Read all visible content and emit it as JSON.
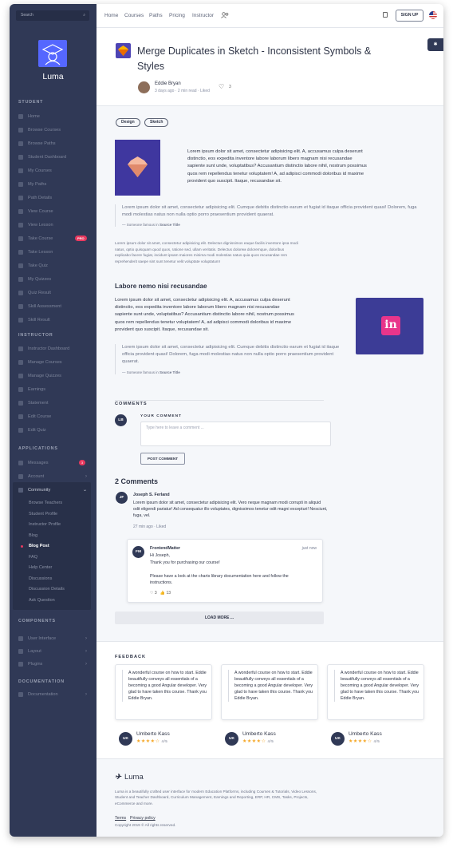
{
  "sidebar": {
    "search_placeholder": "Search",
    "brand": "Luma",
    "sections": {
      "student": "STUDENT",
      "instructor": "INSTRUCTOR",
      "applications": "APPLICATIONS",
      "components": "COMPONENTS",
      "documentation": "DOCUMENTATION"
    },
    "student_items": [
      "Home",
      "Browse Courses",
      "Browse Paths",
      "Student Dashboard",
      "My Courses",
      "My Paths",
      "Path Details",
      "View Course",
      "View Lesson",
      "Take Course",
      "Take Lesson",
      "Take Quiz",
      "My Quizzes",
      "Quiz Result",
      "Skill Assessment",
      "Skill Result"
    ],
    "take_course_badge": "PRO",
    "instructor_items": [
      "Instructor Dashboard",
      "Manage Courses",
      "Manage Quizzes",
      "Earnings",
      "Statement",
      "Edit Course",
      "Edit Quiz"
    ],
    "app_items": [
      "Messages",
      "Account",
      "Community"
    ],
    "messages_badge": "3",
    "community_sub": [
      "Browse Teachers",
      "Student Profile",
      "Instructor Profile",
      "Blog",
      "Blog Post",
      "FAQ",
      "Help Center",
      "Discussions",
      "Discussion Details",
      "Ask Question"
    ],
    "component_items": [
      "User Interface",
      "Layout",
      "Plugins"
    ],
    "doc_items": [
      "Documentation"
    ]
  },
  "topbar": {
    "nav": [
      "Home",
      "Courses",
      "Paths",
      "Pricing",
      "Instructor"
    ],
    "signup": "SIGN UP"
  },
  "post": {
    "title": "Merge Duplicates in Sketch - Inconsistent Symbols & Styles",
    "author": "Eddie Bryan",
    "meta": "3 days ago · 2 min read · Liked",
    "likes": "3",
    "tags": [
      "Design",
      "Sketch"
    ],
    "intro": "Lorem ipsum dolor sit amet, consectetur adipisicing elit. A, accusamus culpa deserunt distinctio, eos expedita inventore labore laborum libero magnam nisi recusandae sapiente sunt unde, voluptatibus? Accusantium distinctio labore nihil, nostrum possimus quos rem repellendus tenetur voluptatem! A, ad adipisci commodi doloribus id maxime provident quo suscipit. Itaque, recusandae sit.",
    "quote1": "Lorem ipsum dolor sit amet, consectetur adipisicing elit. Cumque debitis distinctio earum et fugiat id itaque officia provident quasi! Dolorem, fuga modi molestias natus non nulla optio porro praesentium provident quaerat.",
    "cite_prefix": "— Someone famous in ",
    "cite_source": "Source Title",
    "small_para": "Lorem ipsum dolor sit amet, consectetur adipisicing elit. Delectus dignissimos eaque facilis inventore ipsa modi natus, optio quisquam quod quos, ratione sed, ullam veritatis. Delectus doloreм doloremque, doloribus explicabo facere fugiat, incidunt ipsam maiores minima modi molestias natus quia quos recusandae rem reprehenderit saepe sint sunt tenetur velit voluptate voluptatum!",
    "subheading": "Labore nemo nisi recusandae",
    "para2": "Lorem ipsum dolor sit amet, consectetur adipisicing elit. A, accusamus culpa deserunt distinctio, eos expedita inventore labore laborum libero magnam nisi recusandae sapiente sunt unde, voluptatibus? Accusantium distinctio labore nihil, nostrum possimus quos rem repellendus tenetur voluptatem! A, ad adipisci commodi doloribus id maxime provident quo suscipit. Itaque, recusandae sit.",
    "quote2": "Lorem ipsum dolor sit amet, consectetur adipisicing elit. Cumque debitis distinctio earum et fugiat id itaque officia provident quasi! Dolorem, fuga modi molestias natus non nulla optio porro praesentium provident quaerat."
  },
  "comments": {
    "section_title": "COMMENTS",
    "your_comment": "YOUR COMMENT",
    "my_initials": "LB",
    "placeholder": "Type here to leave a comment ...",
    "post_button": "POST COMMENT",
    "count_title": "2 Comments",
    "c1": {
      "initials": "JF",
      "name": "Joseph S. Ferland",
      "text": "Lorem ipsum dolor sit amet, consectetur adipisicing elit. Vero neque magnam modi corrupti in aliquid odit eligendi pariatur! Ad consequatur illo voluptates, dignissimos tenetur odit magni excepturi! Nesciunt, fuga, vel.",
      "meta": "27 min ago · Liked"
    },
    "reply": {
      "initials": "FM",
      "name": "FrontendMatter",
      "time": "just now",
      "line1": "Hi Joseph,",
      "line2": "Thank you for purchasing our course!",
      "line3": "Please have a look at the charts library documentation here and follow the instructions.",
      "hearts": "3",
      "thumbs": "13"
    },
    "load_more": "LOAD MORE ..."
  },
  "feedback": {
    "title": "FEEDBACK",
    "cards": [
      {
        "text": "A wonderful course on how to start. Eddie beautifully conveys all essentials of a becoming a good Angular developer. Very glad to have taken this course. Thank you Eddie Bryan.",
        "initials": "UK",
        "name": "Umberto Kass",
        "rating": "4/5",
        "stars": 4
      },
      {
        "text": "A wonderful course on how to start. Eddie beautifully conveys all essentials of a becoming a good Angular developer. Very glad to have taken this course. Thank you Eddie Bryan.",
        "initials": "UK",
        "name": "Umberto Kass",
        "rating": "4/5",
        "stars": 4
      },
      {
        "text": "A wonderful course on how to start. Eddie beautifully conveys all essentials of a becoming a good Angular developer. Very glad to have taken this course. Thank you Eddie Bryan.",
        "initials": "UK",
        "name": "Umberto Kass",
        "rating": "4/5",
        "stars": 4
      }
    ]
  },
  "footer": {
    "brand": "Luma",
    "desc": "Luma is a beautifully crafted user interface for modern Education Platforms, including Courses & Tutorials, Video Lessons, Student and Teacher Dashboard, Curriculum Management, Earnings and Reporting, ERP, HR, CMS, Tasks, Projects, eCommerce and more.",
    "terms": "Terms",
    "privacy": "Privacy policy",
    "copyright": "Copyright 2019 © All rights reserved."
  },
  "colors": {
    "sidebar": "#303956",
    "accent": "#5567ff",
    "badge": "#e8395f",
    "star": "#f5a623"
  }
}
